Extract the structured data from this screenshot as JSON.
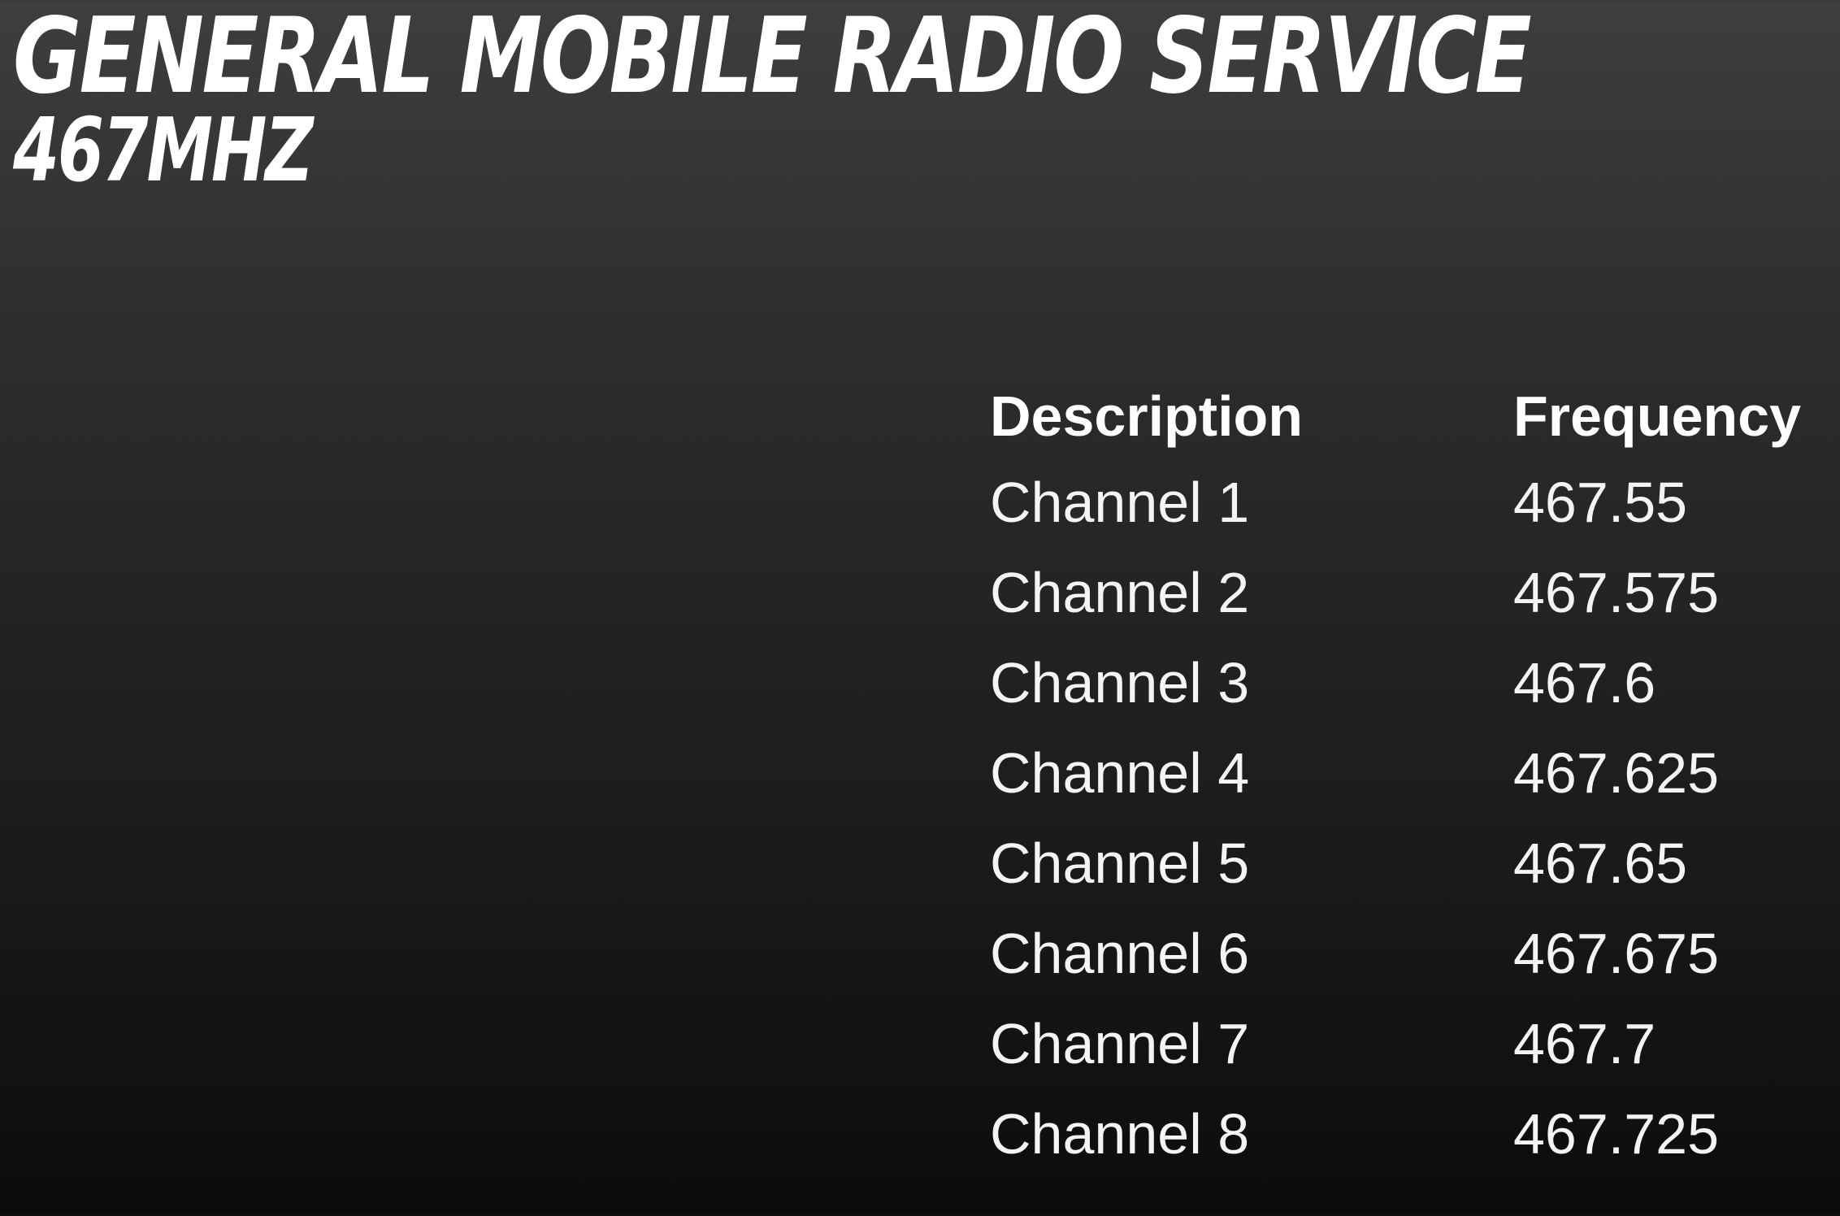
{
  "slide": {
    "title": "General Mobile Radio Service",
    "subtitle": "467MHZ"
  },
  "table": {
    "headers": {
      "description": "Description",
      "frequency": "Frequency"
    },
    "rows": [
      {
        "description": "Channel 1",
        "frequency": "467.55"
      },
      {
        "description": "Channel 2",
        "frequency": "467.575"
      },
      {
        "description": "Channel 3",
        "frequency": "467.6"
      },
      {
        "description": "Channel 4",
        "frequency": "467.625"
      },
      {
        "description": "Channel 5",
        "frequency": "467.65"
      },
      {
        "description": "Channel 6",
        "frequency": "467.675"
      },
      {
        "description": "Channel 7",
        "frequency": "467.7"
      },
      {
        "description": "Channel 8",
        "frequency": "467.725"
      }
    ]
  }
}
